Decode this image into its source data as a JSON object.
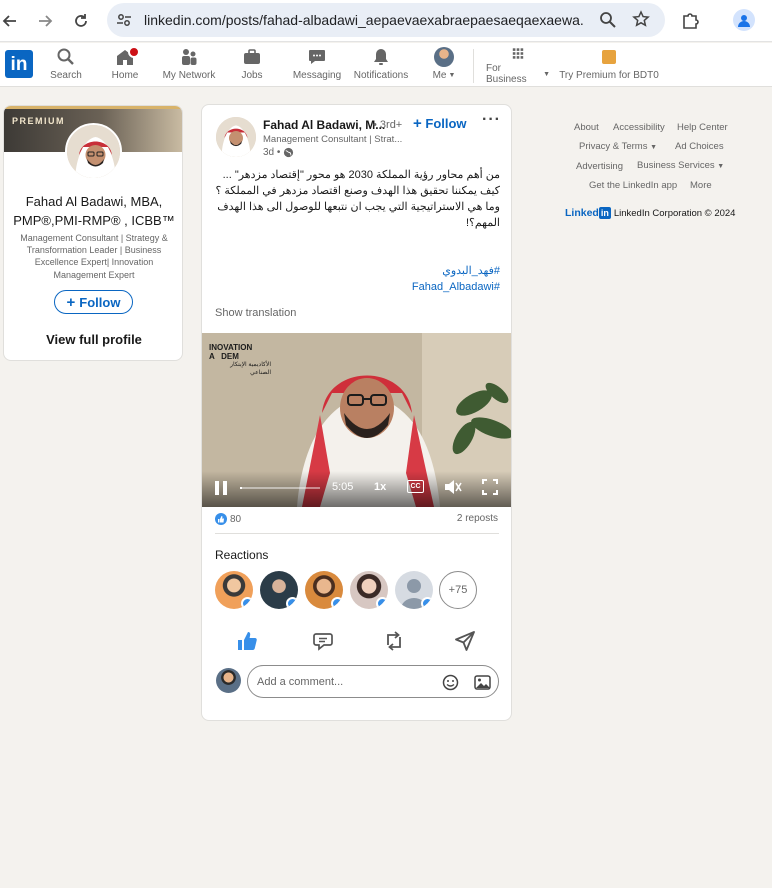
{
  "browser": {
    "url": "linkedin.com/posts/fahad-albadawi_aepaevaexabraepaesaeqaexaewa...",
    "icons": [
      "back-icon",
      "forward-icon",
      "reload-icon",
      "site-info-icon",
      "zoom-icon",
      "star-icon",
      "extensions-icon",
      "account-icon"
    ]
  },
  "nav": {
    "logo": "in",
    "items": [
      {
        "label": "Search",
        "icon": "search-icon"
      },
      {
        "label": "Home",
        "icon": "home-icon",
        "badge": true
      },
      {
        "label": "My Network",
        "icon": "network-icon"
      },
      {
        "label": "Jobs",
        "icon": "jobs-icon"
      },
      {
        "label": "Messaging",
        "icon": "messaging-icon"
      },
      {
        "label": "Notifications",
        "icon": "bell-icon"
      },
      {
        "label": "Me",
        "icon": "avatar"
      },
      {
        "label": "For Business",
        "icon": "grid-icon"
      },
      {
        "label": "Try Premium for BDT0",
        "icon": "premium-icon"
      }
    ]
  },
  "profile": {
    "premium_label": "PREMIUM",
    "name": "Fahad Al Badawi, MBA, PMP®,PMI-RMP® , ICBB™",
    "headline": "Management Consultant | Strategy & Transformation Leader | Business Excellence Expert| Innovation Management Expert",
    "follow_label": "Follow",
    "view_profile_label": "View full profile"
  },
  "post": {
    "author": "Fahad Al Badawi, M...",
    "degree": "• 3rd+",
    "headline": "Management Consultant | Strat...",
    "time": "3d •",
    "follow_label": "Follow",
    "more_label": "···",
    "body": "من أهم محاور رؤية المملكة 2030 هو محور \"إقتصاد مزدهر\" ... كيف يمكننا تحقيق هذا الهدف وصنع اقتصاد مزدهر في المملكة ؟ وما هي الاستراتيجية التي يجب ان نتبعها للوصول الى هذا الهدف المهم؟!",
    "hashtag_1": "#فهد_البدوي",
    "hashtag_2": "#Fahad_Albadawi",
    "show_translation": "Show translation",
    "video": {
      "watermark_line1": "INOVATION",
      "watermark_line2": "A   DEM",
      "watermark_arabic": "الأكاديمية الإبتكار الصناعي",
      "time": "5:05",
      "speed": "1x",
      "cc": "CC",
      "progress": 0.02
    },
    "reaction_count": "80",
    "reposts": "2 reposts",
    "reactions_title": "Reactions",
    "reactors_more": "+75",
    "actions": [
      "like-icon",
      "comment-icon",
      "repost-icon",
      "send-icon"
    ],
    "comment_placeholder": "Add a comment..."
  },
  "footer": {
    "links": [
      "About",
      "Accessibility",
      "Help Center",
      "Privacy & Terms",
      "Ad Choices",
      "Advertising",
      "Business Services",
      "Get the LinkedIn app",
      "More"
    ],
    "brand_word": "Linked",
    "brand_in": "in",
    "copyright": "LinkedIn Corporation © 2024"
  },
  "colors": {
    "accent": "#0a66c2",
    "page_bg": "#f4f2ee",
    "badge": "#cc1016"
  }
}
